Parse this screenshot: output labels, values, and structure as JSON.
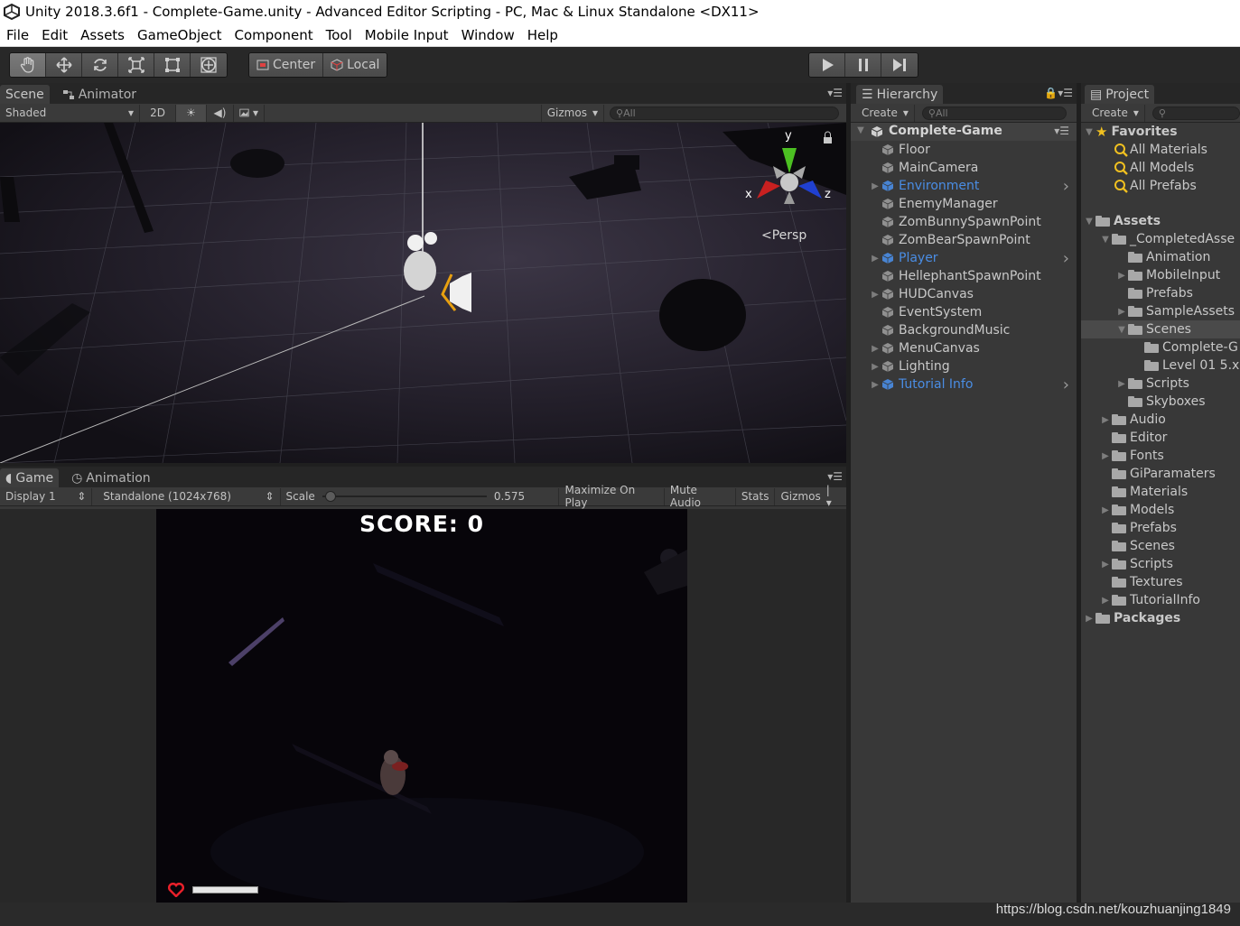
{
  "window": {
    "title": "Unity 2018.3.6f1 - Complete-Game.unity - Advanced Editor Scripting - PC, Mac & Linux Standalone <DX11>"
  },
  "menu": [
    "File",
    "Edit",
    "Assets",
    "GameObject",
    "Component",
    "Tool",
    "Mobile Input",
    "Window",
    "Help"
  ],
  "toolbar": {
    "tools": [
      "hand-tool-icon",
      "move-tool-icon",
      "rotate-tool-icon",
      "scale-tool-icon",
      "rect-tool-icon",
      "transform-tool-icon"
    ],
    "pivot_label": "Center",
    "space_label": "Local"
  },
  "scene_panel": {
    "tabs": [
      "Scene",
      "Animator"
    ],
    "shading": "Shaded",
    "mode_2d": "2D",
    "gizmos": "Gizmos",
    "search_placeholder": "All",
    "persp_label": "Persp",
    "axis_labels": {
      "x": "x",
      "y": "y",
      "z": "z"
    }
  },
  "game_panel": {
    "tabs": [
      "Game",
      "Animation"
    ],
    "display": "Display 1",
    "resolution": "Standalone (1024x768)",
    "scale_label": "Scale",
    "scale_value": "0.575",
    "scale_fraction": 0.02,
    "maximize": "Maximize On Play",
    "mute": "Mute Audio",
    "stats": "Stats",
    "gizmos": "Gizmos",
    "score_text": "SCORE: 0",
    "health_fraction": 1.0
  },
  "hierarchy": {
    "tab": "Hierarchy",
    "create": "Create",
    "search_placeholder": "All",
    "scene_name": "Complete-Game",
    "items": [
      {
        "label": "Floor",
        "expandable": false,
        "prefab": false
      },
      {
        "label": "MainCamera",
        "expandable": false,
        "prefab": false
      },
      {
        "label": "Environment",
        "expandable": true,
        "prefab": true
      },
      {
        "label": "EnemyManager",
        "expandable": false,
        "prefab": false
      },
      {
        "label": "ZomBunnySpawnPoint",
        "expandable": false,
        "prefab": false
      },
      {
        "label": "ZomBearSpawnPoint",
        "expandable": false,
        "prefab": false
      },
      {
        "label": "Player",
        "expandable": true,
        "prefab": true
      },
      {
        "label": "HellephantSpawnPoint",
        "expandable": false,
        "prefab": false
      },
      {
        "label": "HUDCanvas",
        "expandable": true,
        "prefab": false
      },
      {
        "label": "EventSystem",
        "expandable": false,
        "prefab": false
      },
      {
        "label": "BackgroundMusic",
        "expandable": false,
        "prefab": false
      },
      {
        "label": "MenuCanvas",
        "expandable": true,
        "prefab": false
      },
      {
        "label": "Lighting",
        "expandable": true,
        "prefab": false
      },
      {
        "label": "Tutorial Info",
        "expandable": true,
        "prefab": true
      }
    ]
  },
  "project": {
    "tab": "Project",
    "create": "Create",
    "favorites_label": "Favorites",
    "favorites": [
      "All Materials",
      "All Models",
      "All Prefabs"
    ],
    "assets_label": "Assets",
    "tree": [
      {
        "label": "_CompletedAsse",
        "depth": 1,
        "arrow": "down"
      },
      {
        "label": "Animation",
        "depth": 2,
        "arrow": ""
      },
      {
        "label": "MobileInput",
        "depth": 2,
        "arrow": "right"
      },
      {
        "label": "Prefabs",
        "depth": 2,
        "arrow": ""
      },
      {
        "label": "SampleAssets",
        "depth": 2,
        "arrow": "right"
      },
      {
        "label": "Scenes",
        "depth": 2,
        "arrow": "down",
        "selected": true
      },
      {
        "label": "Complete-G",
        "depth": 3,
        "arrow": ""
      },
      {
        "label": "Level 01 5.x",
        "depth": 3,
        "arrow": ""
      },
      {
        "label": "Scripts",
        "depth": 2,
        "arrow": "right"
      },
      {
        "label": "Skyboxes",
        "depth": 2,
        "arrow": ""
      },
      {
        "label": "Audio",
        "depth": 1,
        "arrow": "right"
      },
      {
        "label": "Editor",
        "depth": 1,
        "arrow": ""
      },
      {
        "label": "Fonts",
        "depth": 1,
        "arrow": "right"
      },
      {
        "label": "GiParamaters",
        "depth": 1,
        "arrow": ""
      },
      {
        "label": "Materials",
        "depth": 1,
        "arrow": ""
      },
      {
        "label": "Models",
        "depth": 1,
        "arrow": "right"
      },
      {
        "label": "Prefabs",
        "depth": 1,
        "arrow": ""
      },
      {
        "label": "Scenes",
        "depth": 1,
        "arrow": ""
      },
      {
        "label": "Scripts",
        "depth": 1,
        "arrow": "right"
      },
      {
        "label": "Textures",
        "depth": 1,
        "arrow": ""
      },
      {
        "label": "TutorialInfo",
        "depth": 1,
        "arrow": "right"
      }
    ],
    "packages_label": "Packages"
  },
  "watermark": "https://blog.csdn.net/kouzhuanjing1849",
  "colors": {
    "prefab_blue": "#4a8de4",
    "panel_bg": "#383838",
    "tab_bg": "#262626",
    "health_red": "#e8202a"
  }
}
